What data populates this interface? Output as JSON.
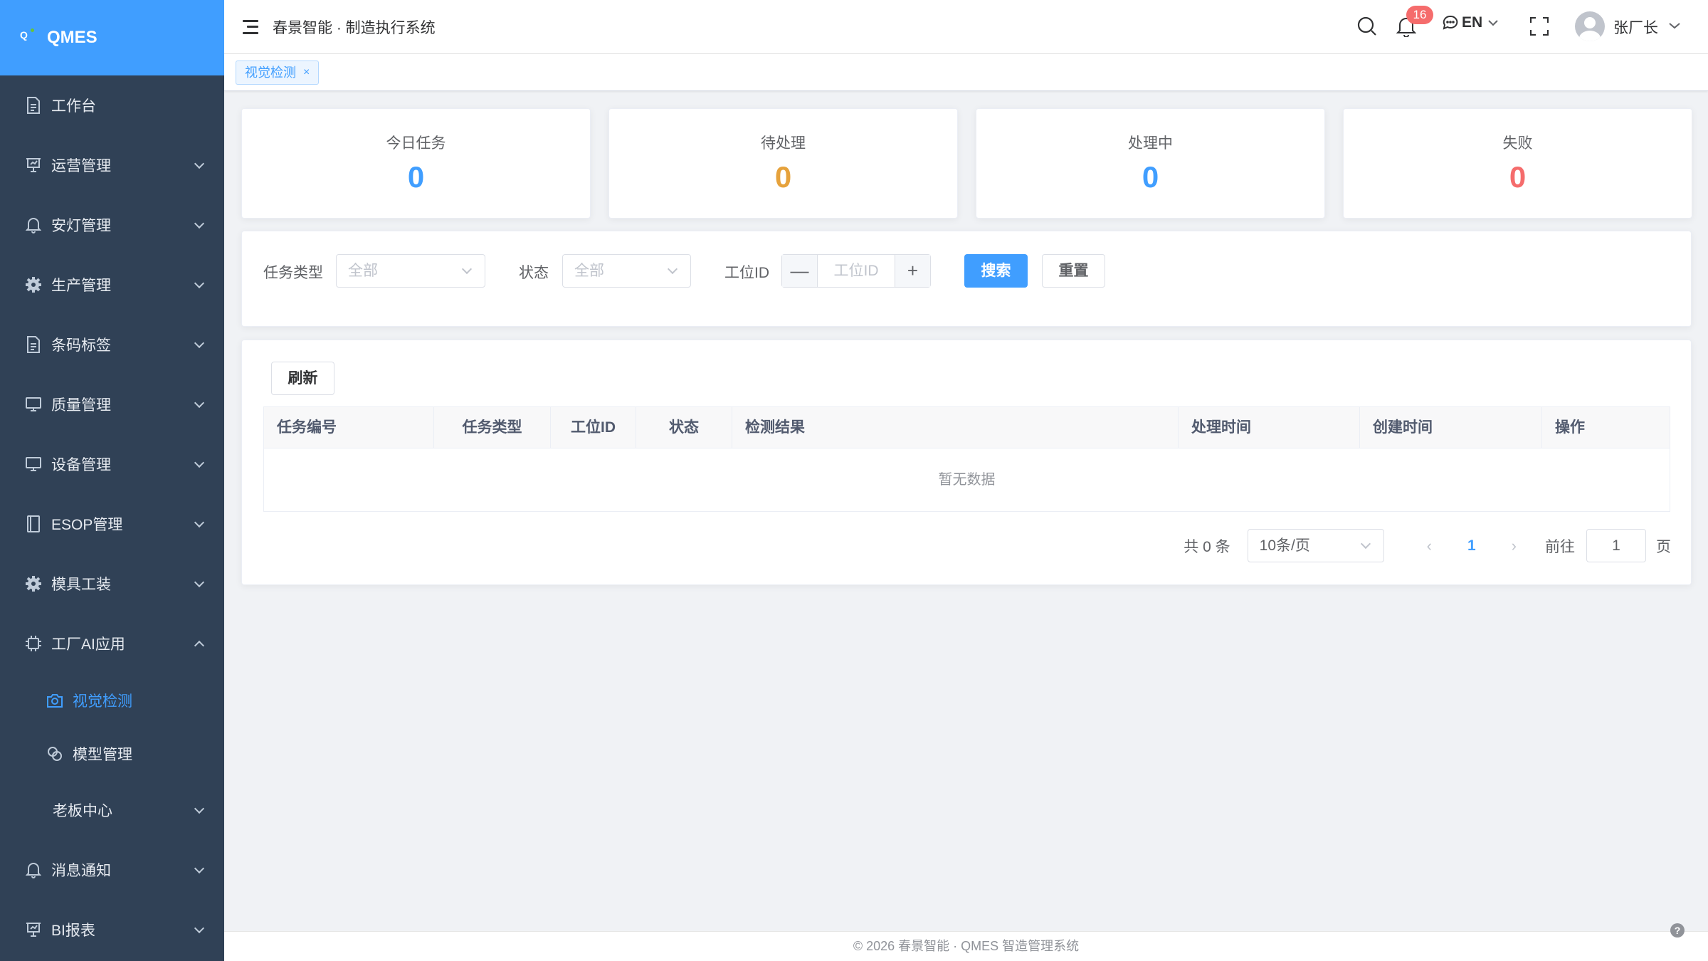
{
  "app": {
    "name": "QMES",
    "title": "春景智能 · 制造执行系统"
  },
  "sidebar": {
    "items": [
      {
        "label": "工作台",
        "icon": "document-icon"
      },
      {
        "label": "运营管理",
        "icon": "presentation-icon"
      },
      {
        "label": "安灯管理",
        "icon": "bell-icon"
      },
      {
        "label": "生产管理",
        "icon": "gear-icon"
      },
      {
        "label": "条码标签",
        "icon": "document-icon"
      },
      {
        "label": "质量管理",
        "icon": "monitor-icon"
      },
      {
        "label": "设备管理",
        "icon": "monitor-icon"
      },
      {
        "label": "ESOP管理",
        "icon": "book-icon"
      },
      {
        "label": "模具工装",
        "icon": "gear-icon"
      },
      {
        "label": "工厂AI应用",
        "icon": "chip-icon"
      },
      {
        "label": "视觉检测",
        "icon": "camera-icon"
      },
      {
        "label": "模型管理",
        "icon": "model-icon"
      },
      {
        "label": "老板中心",
        "icon": ""
      },
      {
        "label": "消息通知",
        "icon": "bell-icon"
      },
      {
        "label": "BI报表",
        "icon": "presentation-icon"
      }
    ]
  },
  "header": {
    "notification_count": "16",
    "lang": "EN",
    "user_name": "张厂长"
  },
  "tags": [
    {
      "label": "视觉检测",
      "close": "×"
    }
  ],
  "stats": [
    {
      "label": "今日任务",
      "value": "0",
      "color": "#409eff"
    },
    {
      "label": "待处理",
      "value": "0",
      "color": "#e6a23c"
    },
    {
      "label": "处理中",
      "value": "0",
      "color": "#409eff"
    },
    {
      "label": "失败",
      "value": "0",
      "color": "#f56c6c"
    }
  ],
  "filter": {
    "task_type_label": "任务类型",
    "task_type_value": "全部",
    "status_label": "状态",
    "status_value": "全部",
    "station_label": "工位ID",
    "station_placeholder": "工位ID",
    "minus": "—",
    "plus": "+",
    "search_label": "搜索",
    "reset_label": "重置"
  },
  "table": {
    "refresh_label": "刷新",
    "columns": [
      "任务编号",
      "任务类型",
      "工位ID",
      "状态",
      "检测结果",
      "处理时间",
      "创建时间",
      "操作"
    ],
    "empty_text": "暂无数据"
  },
  "pagination": {
    "total": "共 0 条",
    "page_size": "10条/页",
    "prev": "‹",
    "current": "1",
    "next": "›",
    "goto_label": "前往",
    "goto_value": "1",
    "page_suffix": "页"
  },
  "footer": {
    "text": "© 2026 春景智能 · QMES 智造管理系统",
    "help": "?"
  }
}
